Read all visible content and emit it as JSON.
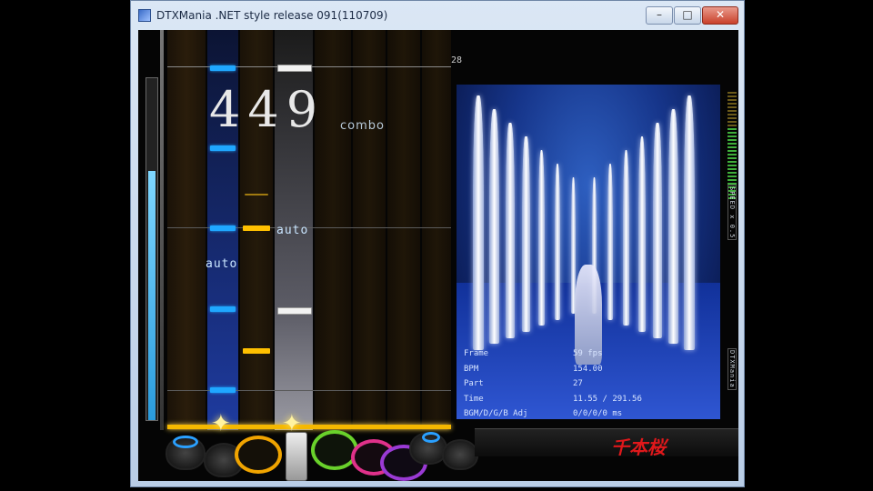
{
  "window": {
    "title": "DTXMania .NET style release 091(110709)",
    "min_glyph": "–",
    "max_glyph": "□",
    "close_glyph": "✕"
  },
  "game": {
    "combo": "449",
    "combo_label": "combo",
    "bar_number": "28",
    "auto_label_1": "auto",
    "auto_label_2": "auto",
    "song_title": "千本桜",
    "meter_label_top": "SPEED x 0.5",
    "meter_label_bottom": "DTXMania",
    "gauge_level": 0.73
  },
  "stats": {
    "frame_label": "Frame",
    "frame_value": "59  fps",
    "bpm_label": "BPM",
    "bpm_value": "154.00",
    "part_label": "Part",
    "part_value": "27",
    "time_label": "Time",
    "time_value": "11.55 / 291.56",
    "bgm_label": "BGM/D/G/B Adj",
    "bgm_value": "0/0/0/0 ms"
  },
  "colors": {
    "chip_blue": "#1fa7ff",
    "chip_yellow": "#ffc000",
    "judge_line": "#f5b800",
    "bga_blue": "#16358a",
    "song_title_red": "#e0181b"
  }
}
